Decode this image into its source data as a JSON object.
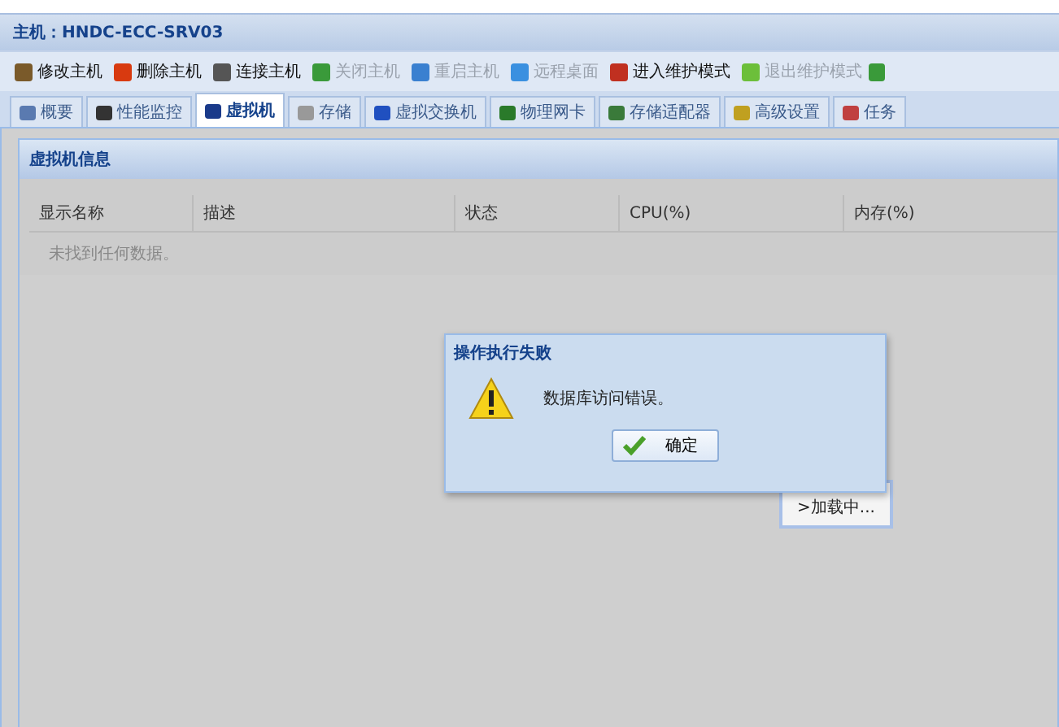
{
  "window": {
    "title": "主机：HNDC-ECC-SRV03"
  },
  "toolbar": [
    {
      "label": "修改主机",
      "disabled": false
    },
    {
      "label": "删除主机",
      "disabled": false
    },
    {
      "label": "连接主机",
      "disabled": false
    },
    {
      "label": "关闭主机",
      "disabled": true
    },
    {
      "label": "重启主机",
      "disabled": true
    },
    {
      "label": "远程桌面",
      "disabled": true
    },
    {
      "label": "进入维护模式",
      "disabled": false
    },
    {
      "label": "退出维护模式",
      "disabled": true
    }
  ],
  "tabs": [
    {
      "label": "概要",
      "selected": false
    },
    {
      "label": "性能监控",
      "selected": false
    },
    {
      "label": "虚拟机",
      "selected": true
    },
    {
      "label": "存储",
      "selected": false
    },
    {
      "label": "虚拟交换机",
      "selected": false
    },
    {
      "label": "物理网卡",
      "selected": false
    },
    {
      "label": "存储适配器",
      "selected": false
    },
    {
      "label": "高级设置",
      "selected": false
    },
    {
      "label": "任务",
      "selected": false
    }
  ],
  "panel": {
    "title": "虚拟机信息",
    "columns": [
      "显示名称",
      "描述",
      "状态",
      "CPU(%)",
      "内存(%)"
    ],
    "empty_text": "未找到任何数据。"
  },
  "loading": {
    "text": ">加载中..."
  },
  "dialog": {
    "title": "操作执行失败",
    "message": "数据库访问错误。",
    "button": "确定"
  }
}
